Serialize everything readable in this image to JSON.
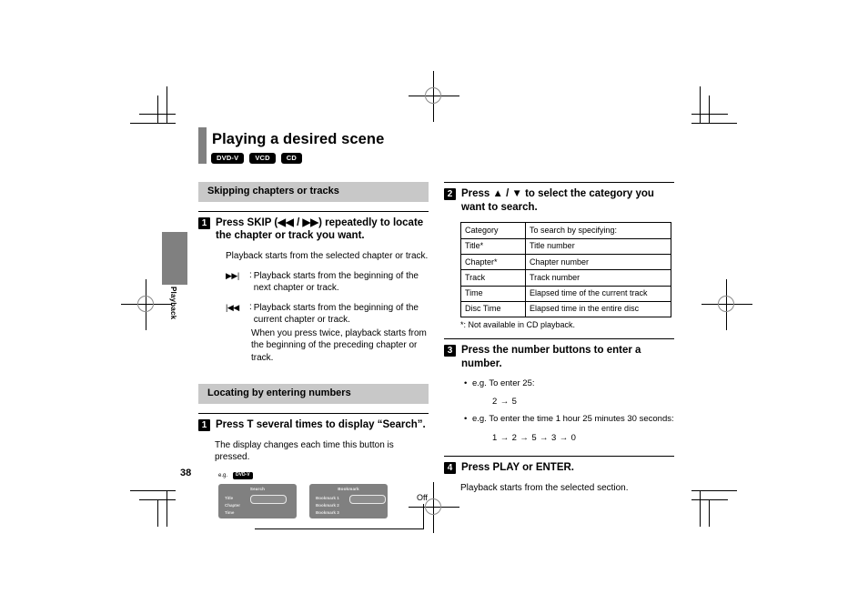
{
  "document": {
    "page_number": "38",
    "side_tab_label": "Playback",
    "title": "Playing a desired scene",
    "disc_badges": [
      "DVD-V",
      "VCD",
      "CD"
    ]
  },
  "left_column": {
    "section1": {
      "heading": "Skipping chapters or tracks",
      "step": {
        "number": "1",
        "text": "Press SKIP (◀◀ / ▶▶) repeatedly to locate the chapter or track you want."
      },
      "intro": "Playback starts from the selected chapter or track.",
      "definitions": [
        {
          "key": "▶▶|",
          "separator": ":",
          "text": "Playback starts from the beginning of the next chapter or track.",
          "continuation": ""
        },
        {
          "key": "|◀◀",
          "separator": ":",
          "text": "Playback starts from the beginning of the current chapter or track.",
          "continuation": "When you press twice, playback starts from the beginning of the preceding chapter or track."
        }
      ]
    },
    "section2": {
      "heading": "Locating by entering numbers",
      "step": {
        "number": "1",
        "text": "Press T several times to display “Search”."
      },
      "body": "The display changes each time this button is pressed.",
      "example": {
        "eg_label": "e.g.",
        "eg_badge": "DVD-V",
        "off_label": "Off",
        "osd_search": {
          "title": "Search",
          "items": [
            "Title",
            "Chapter",
            "Time"
          ]
        },
        "osd_bookmark": {
          "title": "Bookmark",
          "items": [
            "Bookmark 1",
            "Bookmark 2",
            "Bookmark 3"
          ]
        }
      }
    }
  },
  "right_column": {
    "step2": {
      "number": "2",
      "text": "Press ▲ / ▼ to select the category you want to search."
    },
    "category_table": {
      "headers": [
        "Category",
        "To search by specifying:"
      ],
      "rows": [
        [
          "Title*",
          "Title number"
        ],
        [
          "Chapter*",
          "Chapter number"
        ],
        [
          "Track",
          "Track number"
        ],
        [
          "Time",
          "Elapsed time of the current track"
        ],
        [
          "Disc Time",
          "Elapsed time in the entire disc"
        ]
      ],
      "note": "*: Not available in CD playback."
    },
    "step3": {
      "number": "3",
      "text": "Press the number buttons to enter a number.",
      "bullets": [
        {
          "marker": "•",
          "text": "e.g. To enter 25:",
          "sequence": "2 → 5"
        },
        {
          "marker": "•",
          "text": "e.g. To enter the time 1 hour 25 minutes 30 seconds:",
          "sequence": "1 → 2 → 5 → 3 → 0"
        }
      ]
    },
    "step4": {
      "number": "4",
      "text": "Press PLAY or ENTER.",
      "body": "Playback starts from the selected section."
    }
  }
}
